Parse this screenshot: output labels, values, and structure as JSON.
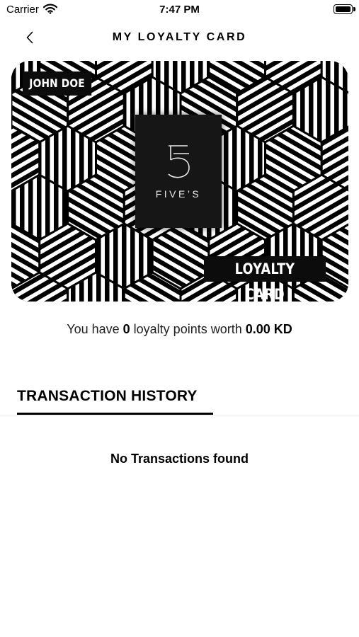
{
  "status_bar": {
    "carrier": "Carrier",
    "time": "7:47 PM",
    "icons": [
      "wifi-icon",
      "battery-icon"
    ]
  },
  "nav": {
    "back_icon": "chevron-left-icon",
    "title": "MY LOYALTY CARD"
  },
  "card": {
    "holder_name": "JOHN DOE",
    "brand_mark": "5",
    "brand_name": "FIVE’S",
    "card_label": "LOYALTY CARD",
    "pattern_colors": [
      "#000000",
      "#ffffff"
    ]
  },
  "points": {
    "prefix": "You have ",
    "value": "0",
    "middle": " loyalty points worth ",
    "amount": "0.00 KD"
  },
  "tabs": [
    {
      "label": "TRANSACTION HISTORY",
      "active": true
    }
  ],
  "transactions": {
    "empty_message": "No Transactions found"
  }
}
